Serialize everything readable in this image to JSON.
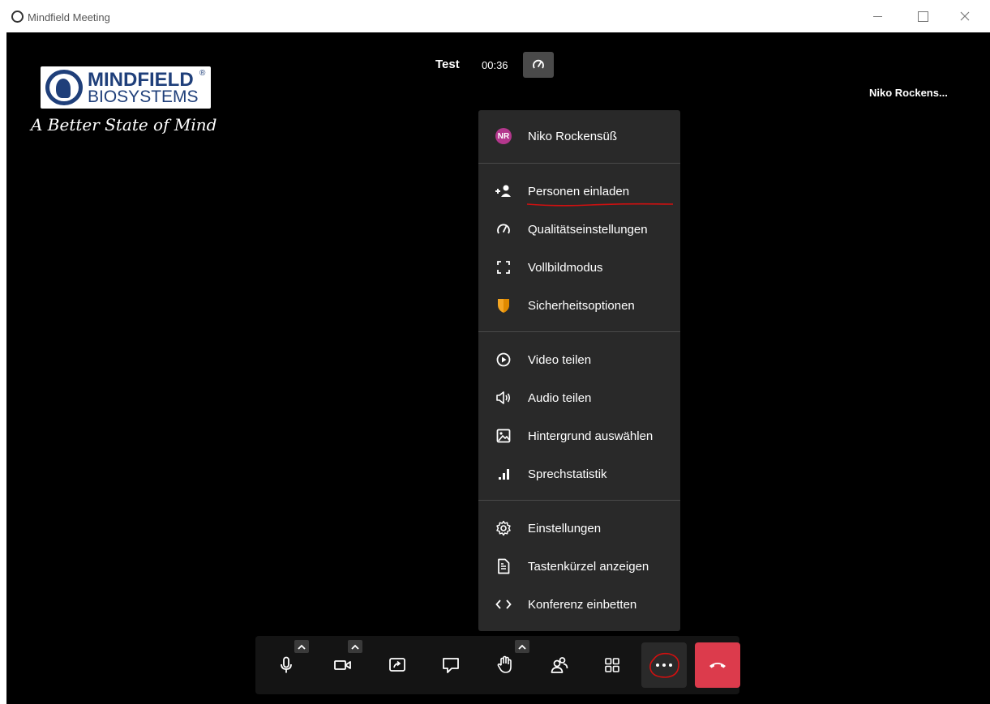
{
  "window": {
    "title": "Mindfield Meeting"
  },
  "logo": {
    "line1": "MINDFIELD",
    "line2": "BIOSYSTEMS",
    "reg": "®",
    "tagline": "A Better State of Mind"
  },
  "meeting": {
    "title": "Test",
    "time": "00:36",
    "participant": "Niko Rockens..."
  },
  "menu": {
    "user": {
      "initials": "NR",
      "name": "Niko Rockensüß"
    },
    "group1": [
      {
        "label": "Personen einladen",
        "icon": "add-person-icon"
      },
      {
        "label": "Qualitätseinstellungen",
        "icon": "gauge-icon"
      },
      {
        "label": "Vollbildmodus",
        "icon": "fullscreen-icon"
      },
      {
        "label": "Sicherheitsoptionen",
        "icon": "shield-icon"
      }
    ],
    "group2": [
      {
        "label": "Video teilen",
        "icon": "play-circle-icon"
      },
      {
        "label": "Audio teilen",
        "icon": "speaker-icon"
      },
      {
        "label": "Hintergrund auswählen",
        "icon": "image-icon"
      },
      {
        "label": "Sprechstatistik",
        "icon": "bar-chart-icon"
      }
    ],
    "group3": [
      {
        "label": "Einstellungen",
        "icon": "gear-icon"
      },
      {
        "label": "Tastenkürzel anzeigen",
        "icon": "document-icon"
      },
      {
        "label": "Konferenz einbetten",
        "icon": "code-icon"
      }
    ]
  },
  "colors": {
    "accent_red": "#dc3b4c",
    "avatar": "#b4378d",
    "shield": "#f5a623",
    "annotation": "#d01010"
  }
}
